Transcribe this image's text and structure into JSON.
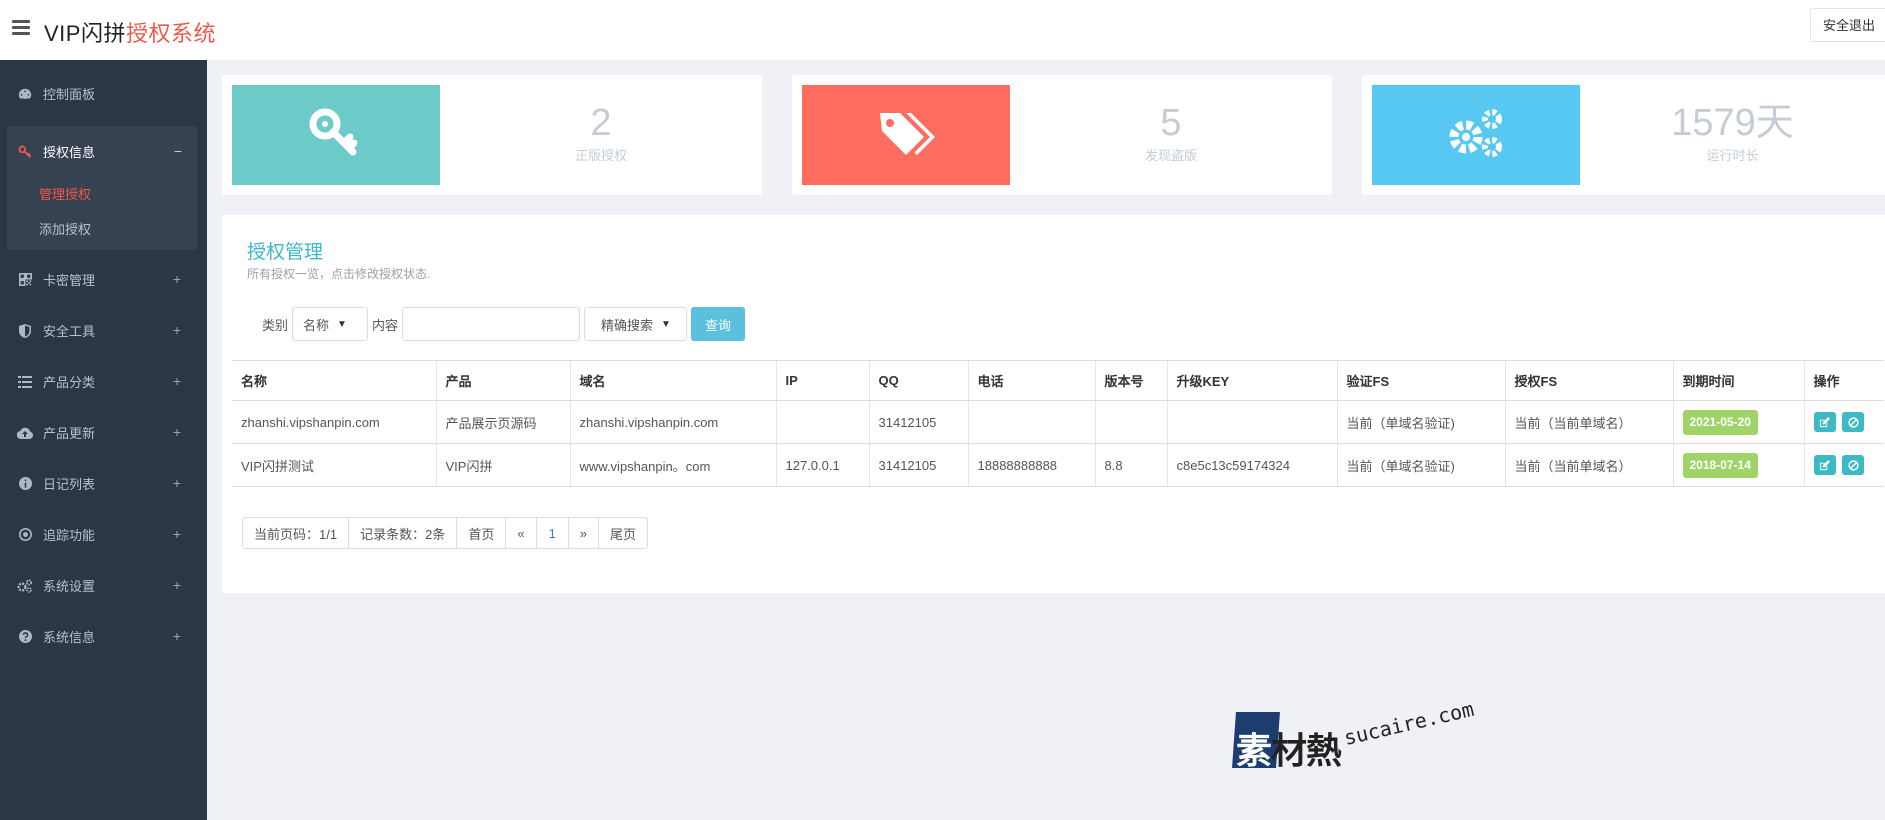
{
  "header": {
    "brand_prefix": "VIP闪拼",
    "brand_accent": "授权系统",
    "logout_label": "安全退出"
  },
  "sidebar": {
    "items": [
      {
        "label": "控制面板",
        "icon": "dashboard-icon"
      },
      {
        "label": "授权信息",
        "icon": "key-icon",
        "toggle": "−",
        "children": [
          {
            "label": "管理授权",
            "active": true
          },
          {
            "label": "添加授权"
          }
        ]
      },
      {
        "label": "卡密管理",
        "icon": "qrcode-icon",
        "toggle": "+"
      },
      {
        "label": "安全工具",
        "icon": "shield-icon",
        "toggle": "+"
      },
      {
        "label": "产品分类",
        "icon": "list-icon",
        "toggle": "+"
      },
      {
        "label": "产品更新",
        "icon": "cloud-upload-icon",
        "toggle": "+"
      },
      {
        "label": "日记列表",
        "icon": "info-circle-icon",
        "toggle": "+"
      },
      {
        "label": "追踪功能",
        "icon": "target-icon",
        "toggle": "+"
      },
      {
        "label": "系统设置",
        "icon": "gears-icon",
        "toggle": "+"
      },
      {
        "label": "系统信息",
        "icon": "question-circle-icon",
        "toggle": "+"
      }
    ]
  },
  "stats": [
    {
      "value": "2",
      "label": "正版授权",
      "color": "#6ccac9",
      "icon": "key-icon"
    },
    {
      "value": "5",
      "label": "发现盗版",
      "color": "#ff6c60",
      "icon": "tags-icon"
    },
    {
      "value": "1579天",
      "label": "运行时长",
      "color": "#57c8f2",
      "icon": "gears-icon"
    }
  ],
  "panel": {
    "title": "授权管理",
    "description": "所有授权一览，点击修改授权状态."
  },
  "search": {
    "category_label": "类别",
    "category_value": "名称",
    "content_label": "内容",
    "content_value": "",
    "mode_value": "精确搜索",
    "query_label": "查询"
  },
  "table": {
    "columns": [
      "名称",
      "产品",
      "域名",
      "IP",
      "QQ",
      "电话",
      "版本号",
      "升级KEY",
      "验证FS",
      "授权FS",
      "到期时间",
      "操作"
    ],
    "rows": [
      {
        "name": "zhanshi.vipshanpin.com",
        "product": "产品展示页源码",
        "domain": "zhanshi.vipshanpin.com",
        "ip": "",
        "qq": "31412105",
        "phone": "",
        "version": "",
        "key": "",
        "verify_fs": "当前（单域名验证)",
        "auth_fs": "当前（当前单域名）",
        "expire": "2021-05-20"
      },
      {
        "name": "VIP闪拼测试",
        "product": "VIP闪拼",
        "domain": "www.vipshanpin。com",
        "ip": "127.0.0.1",
        "qq": "31412105",
        "phone": "18888888888",
        "version": "8.8",
        "key": "c8e5c13c59174324",
        "verify_fs": "当前（单域名验证)",
        "auth_fs": "当前（当前单域名）",
        "expire": "2018-07-14"
      }
    ]
  },
  "pager": {
    "current_page": "当前页码：1/1",
    "record_count": "记录条数：2条",
    "first": "首页",
    "prev": "«",
    "page": "1",
    "next": "»",
    "last": "尾页"
  },
  "watermark": {
    "cn_first": "素",
    "cn_rest": "材熱",
    "en": "sucaire.com"
  }
}
